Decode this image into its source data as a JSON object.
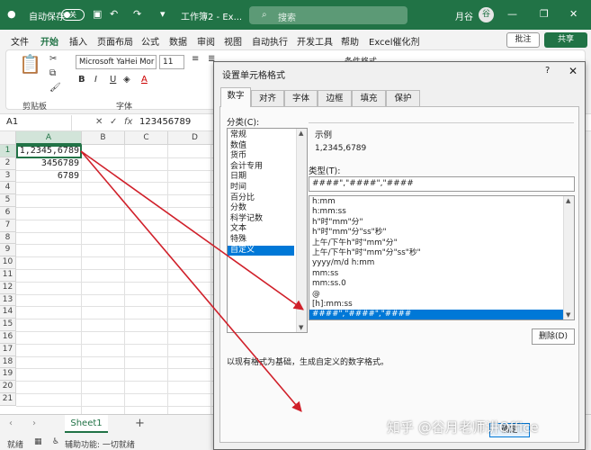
{
  "titlebar": {
    "autosave": "自动保存",
    "autosave_state": "关",
    "doc_title": "工作簿2 - Ex...",
    "search_placeholder": "搜索",
    "user": "月谷",
    "avatar": "谷",
    "icons": [
      "save-icon",
      "undo-icon",
      "redo-icon",
      "customize-icon",
      "minimize-icon",
      "restore-icon",
      "close-icon"
    ],
    "accent": "#217346"
  },
  "ribbon_tabs": [
    "文件",
    "开始",
    "插入",
    "页面布局",
    "公式",
    "数据",
    "审阅",
    "视图",
    "自动执行",
    "开发工具",
    "帮助",
    "Excel催化剂"
  ],
  "active_tab": "开始",
  "comment_button": "批注",
  "share_button": "共享",
  "ribbon": {
    "font_name": "Microsoft YaHei Mor",
    "font_size": "11",
    "bold": "B",
    "italic": "I",
    "underline": "U",
    "font_color": "A",
    "cond_format": "条件格式",
    "groups": [
      "剪贴板",
      "字体"
    ]
  },
  "formula_bar": {
    "name_box": "A1",
    "cancel": "✕",
    "confirm": "✓",
    "fx": "fx",
    "value": "123456789"
  },
  "grid": {
    "columns": [
      "A",
      "B",
      "C",
      "D"
    ],
    "rows": [
      "1",
      "2",
      "3",
      "4",
      "5",
      "6",
      "7",
      "8",
      "9",
      "10",
      "11",
      "12",
      "13",
      "14",
      "15",
      "16",
      "17",
      "18",
      "19",
      "20",
      "21"
    ],
    "cells": [
      "1,2345,6789",
      "3456789",
      "6789"
    ]
  },
  "sheet": {
    "tab": "Sheet1",
    "add": "+"
  },
  "status": {
    "ready": "就绪",
    "accessibility": "辅助功能: 一切就绪"
  },
  "dialog": {
    "title": "设置单元格格式",
    "help": "?",
    "close": "✕",
    "tabs": [
      "数字",
      "对齐",
      "字体",
      "边框",
      "填充",
      "保护"
    ],
    "category_label": "分类(C):",
    "categories": [
      "常规",
      "数值",
      "货币",
      "会计专用",
      "日期",
      "时间",
      "百分比",
      "分数",
      "科学记数",
      "文本",
      "特殊",
      "自定义"
    ],
    "selected_category": "自定义",
    "sample_label": "示例",
    "sample_value": "1,2345,6789",
    "type_label": "类型(T):",
    "type_value": "####\",\"####\",\"####",
    "type_items": [
      "h:mm",
      "h:mm:ss",
      "h\"时\"mm\"分\"",
      "h\"时\"mm\"分\"ss\"秒\"",
      "上午/下午h\"时\"mm\"分\"",
      "上午/下午h\"时\"mm\"分\"ss\"秒\"",
      "yyyy/m/d h:mm",
      "mm:ss",
      "mm:ss.0",
      "@",
      "[h]:mm:ss",
      "####\",\"####\",\"####"
    ],
    "selected_type": "####\",\"####\",\"####",
    "delete_button": "删除(D)",
    "hint": "以现有格式为基础，生成自定义的数字格式。",
    "ok_button": "确定"
  },
  "annotation_color": "#d0202a",
  "watermark": "知乎 @谷月老师讲Office"
}
